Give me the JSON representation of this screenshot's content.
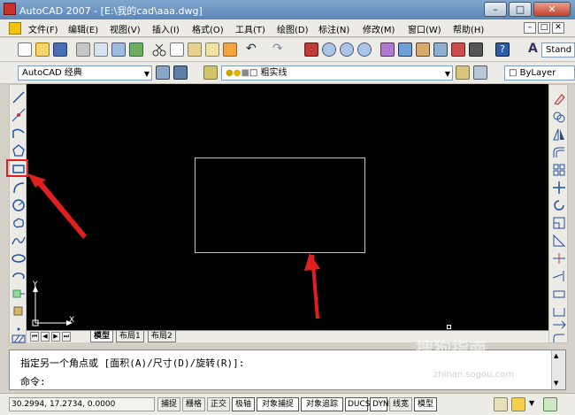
{
  "window": {
    "title": "AutoCAD 2007 - [E:\\我的cad\\aaa.dwg]",
    "buttons": {
      "minimize": "–",
      "maximize": "□",
      "close": "✕"
    }
  },
  "menubar": {
    "items": [
      "文件(F)",
      "编辑(E)",
      "视图(V)",
      "插入(I)",
      "格式(O)",
      "工具(T)",
      "绘图(D)",
      "标注(N)",
      "修改(M)",
      "窗口(W)",
      "帮助(H)"
    ],
    "mdi_buttons": [
      "–",
      "□",
      "✕"
    ]
  },
  "toolbar_standard": {
    "text_style": "Stand"
  },
  "toolbar_workspace": {
    "workspace": "AutoCAD 经典",
    "layer": "粗实线",
    "color": "ByLayer"
  },
  "drawing": {
    "ucs_x": "X",
    "ucs_y": "Y",
    "background": "#000000"
  },
  "tabs": {
    "items": [
      "模型",
      "布局1",
      "布局2"
    ],
    "active": "模型"
  },
  "command": {
    "prompt_line": "指定另一个角点或 [面积(A)/尺寸(D)/旋转(R)]:",
    "input_line": "命令:"
  },
  "statusbar": {
    "coords": "30.2994, 17.2734, 0.0000",
    "toggles": [
      "捕捉",
      "栅格",
      "正交",
      "极轴",
      "对象捕捉",
      "对象追踪",
      "DUCS",
      "DYN",
      "线宽",
      "模型"
    ]
  },
  "watermark": {
    "main": "搜狗指南",
    "sub": "zhinan.sogou.com"
  },
  "colors": {
    "annotation": "#e02020",
    "canvas": "#000000",
    "chrome": "#ecebe5"
  }
}
